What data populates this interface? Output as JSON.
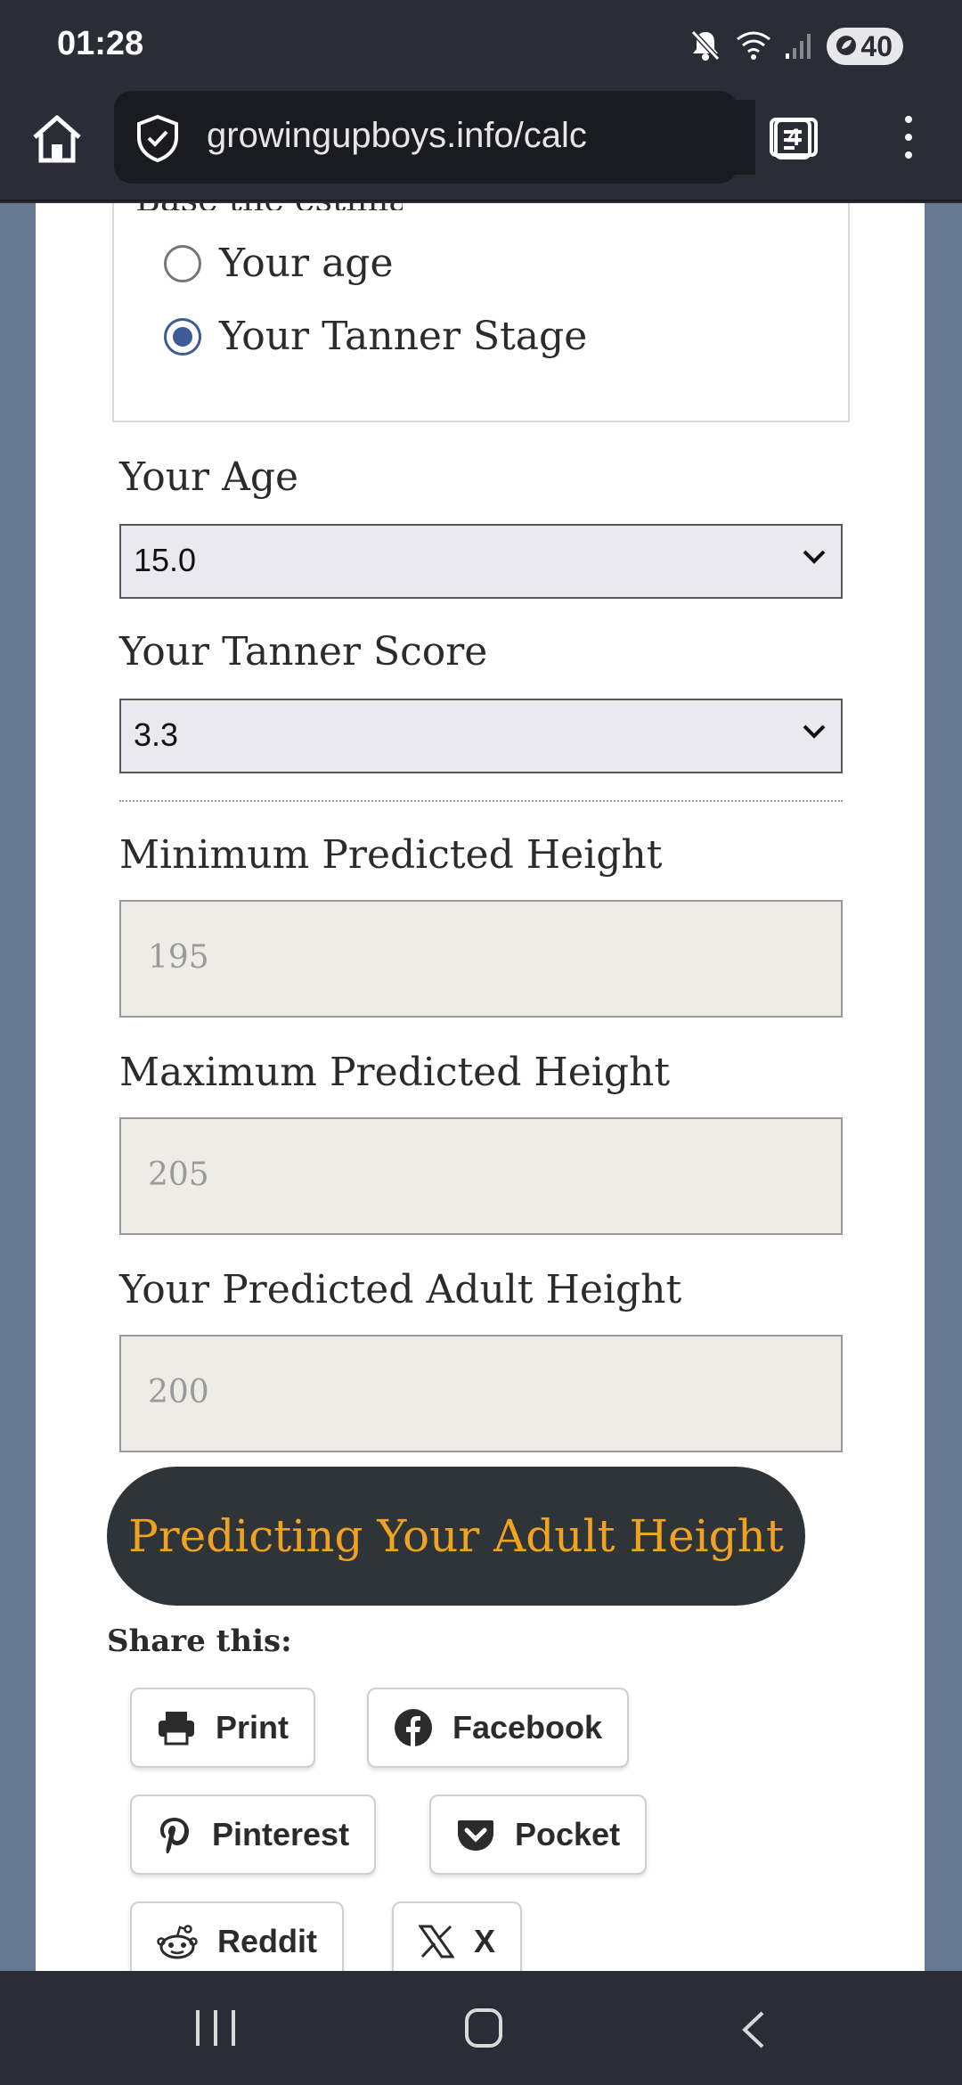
{
  "status_bar": {
    "time": "01:28",
    "battery": "40"
  },
  "browser": {
    "url": "growingupboys.info/calc",
    "tab_count": "4"
  },
  "form": {
    "radio_group_legend": "Base the estimate on",
    "radio_options": [
      {
        "label": "Your age",
        "checked": false
      },
      {
        "label": "Your Tanner Stage",
        "checked": true
      }
    ],
    "age_label": "Your Age",
    "age_value": "15.0",
    "tanner_label": "Your Tanner Score",
    "tanner_value": "3.3",
    "min_height_label": "Minimum Predicted Height",
    "min_height_value": "195",
    "max_height_label": "Maximum Predicted Height",
    "max_height_value": "205",
    "predicted_label": "Your Predicted Adult Height",
    "predicted_value": "200"
  },
  "cta_label": "Predicting Your Adult Height",
  "share": {
    "title": "Share this:",
    "buttons": [
      {
        "label": "Print",
        "icon": "print-icon"
      },
      {
        "label": "Facebook",
        "icon": "facebook-icon"
      },
      {
        "label": "Pinterest",
        "icon": "pinterest-icon"
      },
      {
        "label": "Pocket",
        "icon": "pocket-icon"
      },
      {
        "label": "Reddit",
        "icon": "reddit-icon"
      },
      {
        "label": "X",
        "icon": "x-icon"
      }
    ]
  },
  "colors": {
    "accent": "#3d5b96",
    "cta_text": "#f0a320",
    "cta_bg": "#2f3439",
    "page_bg": "#667b92"
  }
}
